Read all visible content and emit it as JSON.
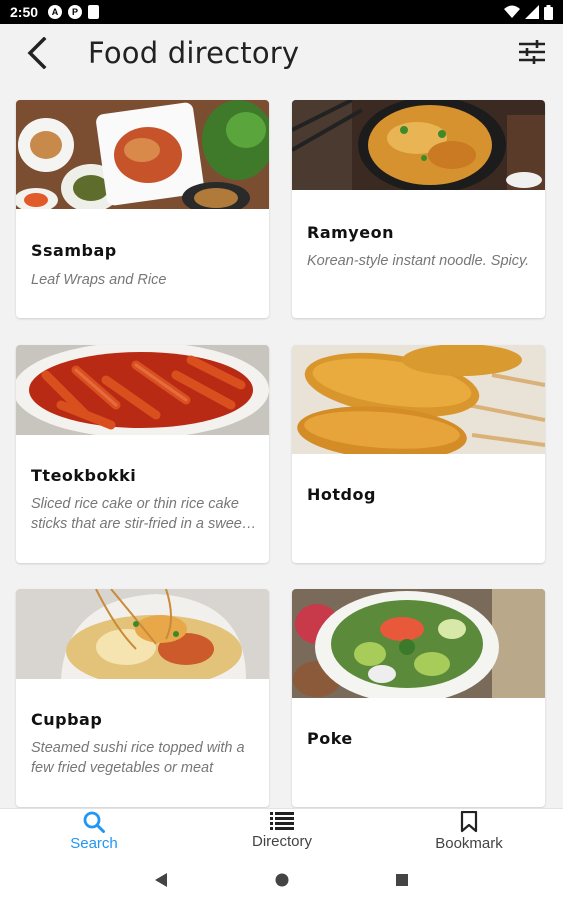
{
  "status_bar": {
    "time": "2:50",
    "icons": [
      "a-icon",
      "p-icon",
      "sim-icon",
      "wifi-icon",
      "signal-icon",
      "battery-icon"
    ]
  },
  "app_bar": {
    "title": "Food directory",
    "back_icon": "arrow-back-icon",
    "filter_icon": "filter-sliders-icon"
  },
  "foods": [
    {
      "name": "Ssambap",
      "description": "Leaf Wraps and Rice"
    },
    {
      "name": "Ramyeon",
      "description": "Korean-style instant noodle. Spicy."
    },
    {
      "name": "Tteokbokki",
      "description": "Sliced rice cake or thin rice cake sticks that are stir-fried in a sweet and spicy sauce"
    },
    {
      "name": "Hotdog",
      "description": ""
    },
    {
      "name": "Cupbap",
      "description": "Steamed sushi rice topped with a few fried vegetables or meat"
    },
    {
      "name": "Poke",
      "description": ""
    }
  ],
  "bottom_nav": {
    "items": [
      {
        "label": "Search",
        "icon": "search-icon",
        "active": true
      },
      {
        "label": "Directory",
        "icon": "list-icon",
        "active": false
      },
      {
        "label": "Bookmark",
        "icon": "bookmark-icon",
        "active": false
      }
    ]
  },
  "colors": {
    "accent": "#2196f3",
    "background": "#f2f2f2",
    "card": "#ffffff",
    "description_text": "#777777"
  }
}
